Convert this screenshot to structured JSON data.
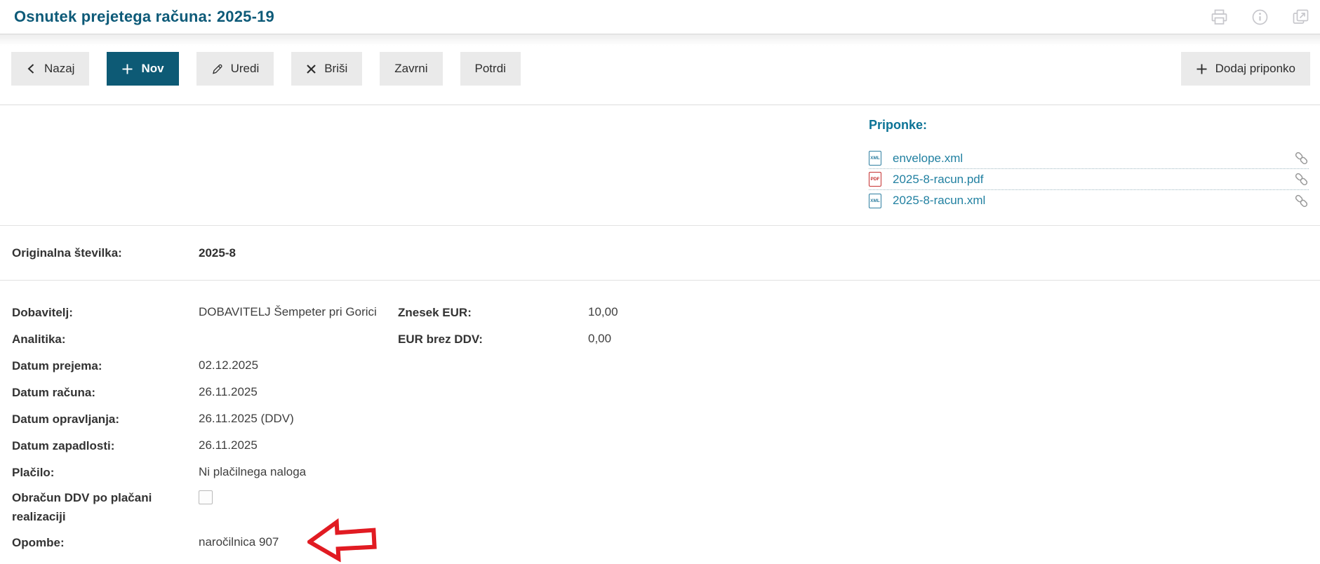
{
  "header": {
    "title": "Osnutek prejetega računa: 2025-19",
    "icons": [
      "printer",
      "info",
      "open-in-new"
    ]
  },
  "toolbar": {
    "buttons": [
      {
        "label": "Nazaj",
        "icon": "chevron-left"
      },
      {
        "label": "Nov",
        "icon": "plus",
        "primary": true
      },
      {
        "label": "Uredi",
        "icon": "pencil"
      },
      {
        "label": "Briši",
        "icon": "x-mark"
      },
      {
        "label": "Zavrni",
        "icon": null
      },
      {
        "label": "Potrdi",
        "icon": null
      }
    ],
    "add_attachment_label": "Dodaj priponko"
  },
  "attachments": {
    "heading": "Priponke:",
    "files": [
      {
        "name": "envelope.xml",
        "type": "XML"
      },
      {
        "name": "2025-8-racun.pdf",
        "type": "PDF"
      },
      {
        "name": "2025-8-racun.xml",
        "type": "XML"
      }
    ]
  },
  "summary": {
    "original_number_label": "Originalna številka:",
    "original_number_value": "2025-8"
  },
  "details": {
    "left": [
      {
        "label": "Dobavitelj:",
        "value": "DOBAVITELJ Šempeter pri Gorici"
      },
      {
        "label": "Analitika:",
        "value": ""
      },
      {
        "label": "Datum prejema:",
        "value": "02.12.2025"
      },
      {
        "label": "Datum računa:",
        "value": "26.11.2025"
      },
      {
        "label": "Datum opravljanja:",
        "value": "26.11.2025 (DDV)"
      },
      {
        "label": "Datum zapadlosti:",
        "value": "26.11.2025"
      },
      {
        "label": "Plačilo:",
        "value": "Ni plačilnega naloga"
      }
    ],
    "vat_checkbox": {
      "label": "Obračun DDV po plačani realizaciji",
      "checked": false
    },
    "notes": {
      "label": "Opombe:",
      "value": "naročilnica 907"
    },
    "right": [
      {
        "label": "Znesek EUR:",
        "value": "10,00"
      },
      {
        "label": "EUR brez DDV:",
        "value": "0,00"
      }
    ]
  },
  "colors": {
    "brand_teal": "#0d5a75",
    "title_teal": "#0d5a78",
    "heading_teal": "#0b7396",
    "link_teal": "#2180a1",
    "pdf_red": "#c53030",
    "arrow_red": "#e11b22",
    "button_gray": "#eaeaea"
  }
}
